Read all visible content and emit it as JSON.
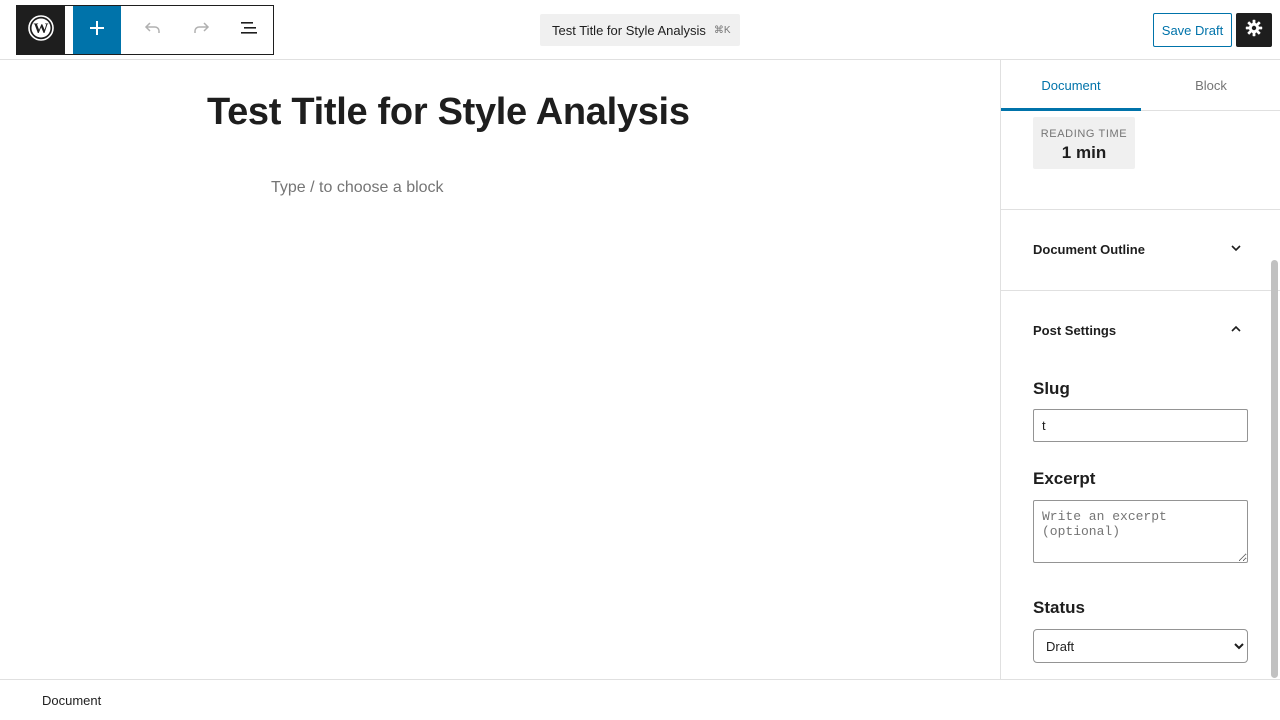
{
  "header": {
    "logo_icon": "wordpress-icon",
    "inserter_icon": "plus-icon",
    "undo_icon": "undo-icon",
    "redo_icon": "redo-icon",
    "list_view_icon": "list-view-icon",
    "command_bar": {
      "title": "Test Title for Style Analysis",
      "shortcut": "⌘K"
    },
    "save_draft_label": "Save Draft",
    "settings_icon": "gear-icon"
  },
  "editor": {
    "post_title": "Test Title for Style Analysis",
    "block_placeholder": "Type / to choose a block"
  },
  "sidebar": {
    "tabs": [
      {
        "label": "Document",
        "active": true
      },
      {
        "label": "Block",
        "active": false
      }
    ],
    "reading_time": {
      "label": "READING TIME",
      "value": "1 min"
    },
    "document_outline": {
      "label": "Document Outline",
      "expanded": false
    },
    "post_settings": {
      "label": "Post Settings",
      "expanded": true,
      "slug": {
        "label": "Slug",
        "value": "t"
      },
      "excerpt": {
        "label": "Excerpt",
        "value": "",
        "placeholder": "Write an excerpt (optional)"
      },
      "status": {
        "label": "Status",
        "selected": "Draft"
      }
    }
  },
  "footer": {
    "breadcrumb": "Document"
  },
  "colors": {
    "accent": "#0073aa",
    "dark": "#1e1e1e",
    "muted": "#757575",
    "border": "#e0e0e0",
    "panel_bg": "#f0f0f0"
  }
}
